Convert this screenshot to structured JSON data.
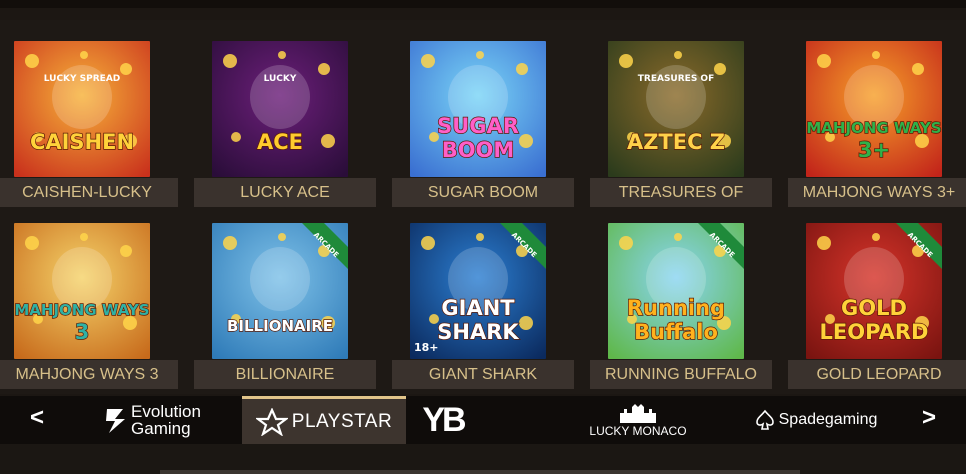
{
  "games": [
    {
      "name": "CAISHEN-LUCKY",
      "art": "CAISHEN",
      "art_sub": "LUCKY SPREAD",
      "badge": "",
      "bg1": "#f7b23a",
      "bg2": "#c9311c",
      "text_color": "#ffd23a"
    },
    {
      "name": "LUCKY ACE",
      "art": "ACE",
      "art_sub": "LUCKY",
      "badge": "",
      "bg1": "#6c1f7a",
      "bg2": "#2a0d39",
      "text_color": "#ffcc2e"
    },
    {
      "name": "SUGAR BOOM",
      "art": "SUGAR BOOM",
      "art_sub": "",
      "badge": "",
      "bg1": "#7ad5f7",
      "bg2": "#3a6fd1",
      "text_color": "#ff5fc8"
    },
    {
      "name": "TREASURES OF",
      "art": "AZTEC Z",
      "art_sub": "TREASURES OF",
      "badge": "",
      "bg1": "#8a6a2a",
      "bg2": "#2b3b1c",
      "text_color": "#ffd24a"
    },
    {
      "name": "MAHJONG WAYS 3+",
      "art": "MAHJONG WAYS 3+",
      "art_sub": "",
      "badge": "",
      "bg1": "#f7a02a",
      "bg2": "#c2241a",
      "text_color": "#2fb14a"
    },
    {
      "name": "MAHJONG WAYS 3",
      "art": "MAHJONG WAYS 3",
      "art_sub": "",
      "badge": "",
      "bg1": "#f5d36a",
      "bg2": "#c76a1b",
      "text_color": "#2fb1a4"
    },
    {
      "name": "BILLIONAIRE",
      "art": "BILLIONAIRE",
      "art_sub": "",
      "badge": "ARCADE",
      "bg1": "#7ec1e8",
      "bg2": "#2f7bb8",
      "text_color": "#ffffff"
    },
    {
      "name": "GIANT SHARK",
      "art": "GIANT SHARK",
      "art_sub": "18+",
      "badge": "ARCADE",
      "bg1": "#2c7fd2",
      "bg2": "#0b2a5e",
      "text_color": "#ffffff"
    },
    {
      "name": "RUNNING BUFFALO",
      "art": "Running Buffalo",
      "art_sub": "",
      "badge": "ARCADE",
      "bg1": "#8ad5f2",
      "bg2": "#5fb84a",
      "text_color": "#ffb21e"
    },
    {
      "name": "GOLD LEOPARD",
      "art": "GOLD LEOPARD",
      "art_sub": "",
      "badge": "ARCADE",
      "bg1": "#d6342a",
      "bg2": "#7a1410",
      "text_color": "#ffd23a"
    }
  ],
  "providers": {
    "prev_arrow": "<",
    "next_arrow": ">",
    "evolution_line1": "Evolution",
    "evolution_line2": "Gaming",
    "playstar": "PLAYSTAR",
    "yb": "YB",
    "lucky_monaco": "LUCKY MONACO",
    "spadegaming": "Spadegaming",
    "active": "PLAYSTAR"
  },
  "colors": {
    "label_bg": "#3a322d",
    "label_text": "#d7c08a",
    "active_border": "#e2c58a",
    "badge_green": "#1f8a3a"
  }
}
